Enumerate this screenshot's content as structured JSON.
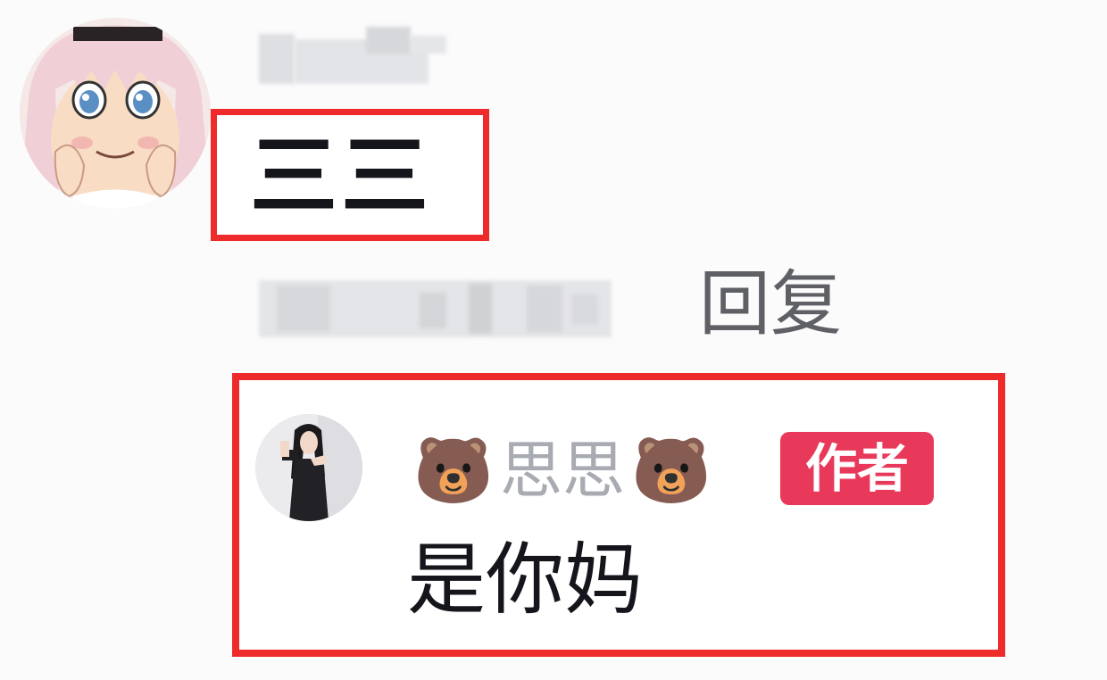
{
  "comment": {
    "avatar_icon": "anime-girl-avatar",
    "text": "三三",
    "reply_label": "回复"
  },
  "reply": {
    "avatar_icon": "woman-photo-avatar",
    "name_prefix_emoji": "🐻",
    "name": "思思",
    "name_suffix_emoji": "🐻",
    "badge": "作者",
    "text": "是你妈"
  },
  "colors": {
    "highlight": "#ee2a2a",
    "badge": "#e8395a",
    "name": "#a8abb2",
    "text": "#15151c"
  }
}
